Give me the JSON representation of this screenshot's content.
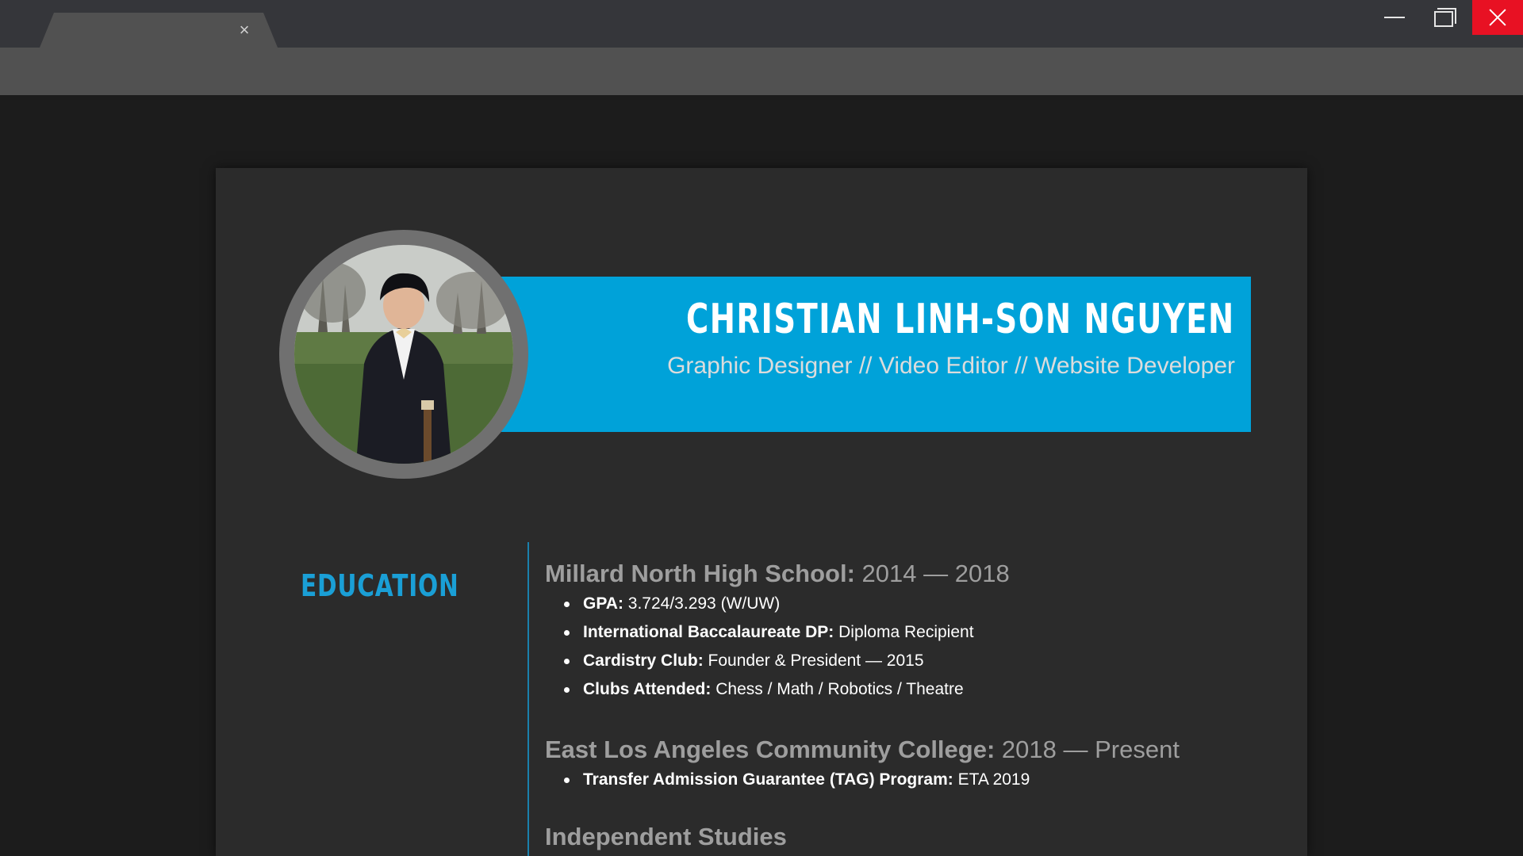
{
  "browser": {
    "tab": {
      "title": "",
      "close_glyph": "×"
    },
    "window_controls": [
      "minimize-icon",
      "maximize-icon",
      "close-icon"
    ],
    "close_color": "#e81123"
  },
  "header": {
    "name": "CHRISTIAN LINH-SON NGUYEN",
    "subtitle": "Graphic Designer // Video Editor // Website Developer",
    "banner_color": "#00a2d9"
  },
  "education": {
    "section_title": "EDUCATION",
    "schools": [
      {
        "name": "Millard North High School:",
        "years": "2014 — 2018",
        "items": [
          {
            "key": "GPA:",
            "value": "3.724/3.293 (W/UW)"
          },
          {
            "key": "International Baccalaureate DP:",
            "value": "Diploma Recipient"
          },
          {
            "key": "Cardistry Club:",
            "value": "Founder & President — 2015"
          },
          {
            "key": "Clubs Attended:",
            "value": "Chess / Math / Robotics / Theatre"
          }
        ]
      },
      {
        "name": "East Los Angeles Community College:",
        "years": "2018 — Present",
        "items": [
          {
            "key": "Transfer Admission Guarantee (TAG) Program:",
            "value": "ETA 2019"
          }
        ]
      },
      {
        "name": "Independent Studies",
        "years": "",
        "items": []
      }
    ]
  }
}
